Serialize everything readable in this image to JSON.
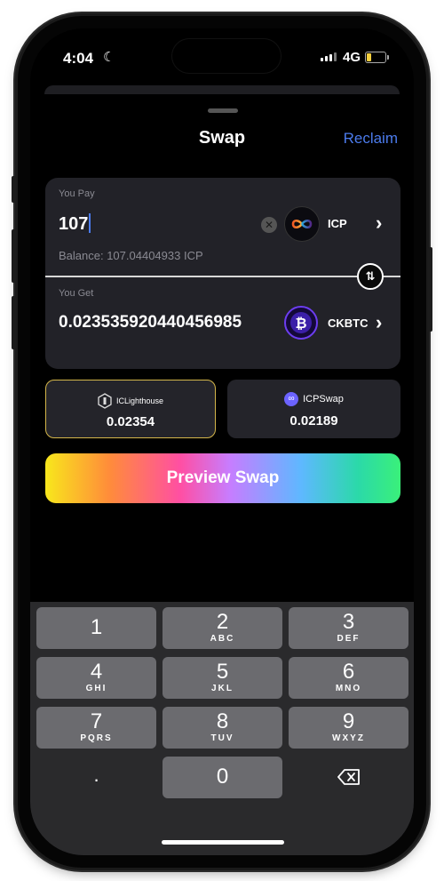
{
  "status_bar": {
    "time": "4:04",
    "network": "4G"
  },
  "header": {
    "title": "Swap",
    "reclaim_label": "Reclaim"
  },
  "pay": {
    "label": "You Pay",
    "amount": "107",
    "token": "ICP",
    "balance": "Balance: 107.04404933 ICP"
  },
  "get": {
    "label": "You Get",
    "amount": "0.023535920440456985",
    "token": "CKBTC"
  },
  "quotes": [
    {
      "source": "ICLighthouse",
      "value": "0.02354",
      "selected": true
    },
    {
      "source": "ICPSwap",
      "value": "0.02189",
      "selected": false
    }
  ],
  "preview_button": "Preview Swap",
  "keypad": {
    "keys": [
      {
        "digit": "1",
        "letters": ""
      },
      {
        "digit": "2",
        "letters": "ABC"
      },
      {
        "digit": "3",
        "letters": "DEF"
      },
      {
        "digit": "4",
        "letters": "GHI"
      },
      {
        "digit": "5",
        "letters": "JKL"
      },
      {
        "digit": "6",
        "letters": "MNO"
      },
      {
        "digit": "7",
        "letters": "PQRS"
      },
      {
        "digit": "8",
        "letters": "TUV"
      },
      {
        "digit": "9",
        "letters": "WXYZ"
      },
      {
        "digit": "0",
        "letters": ""
      }
    ],
    "decimal": "."
  },
  "colors": {
    "accent": "#4b7bec",
    "selected_border": "#d4b64a",
    "card": "#222228"
  },
  "icons": [
    "moon-icon",
    "signal-icon",
    "battery-icon",
    "clear-icon",
    "icp-logo-icon",
    "bitcoin-logo-icon",
    "chevron-right-icon",
    "swap-direction-icon",
    "lighthouse-logo-icon",
    "icpswap-logo-icon",
    "backspace-icon"
  ]
}
